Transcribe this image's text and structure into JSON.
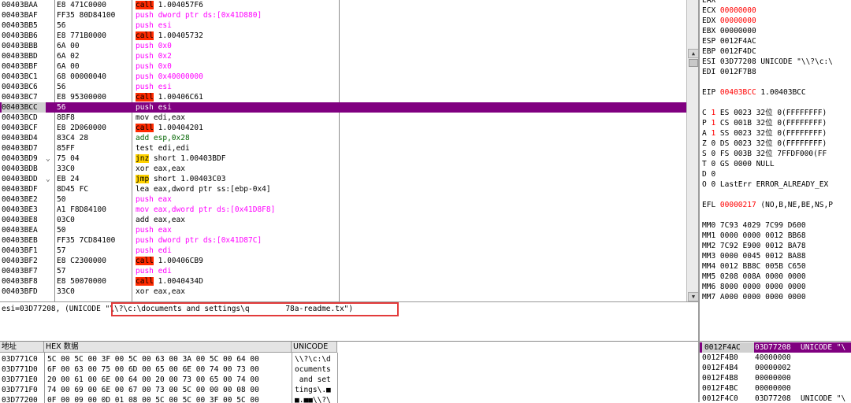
{
  "disasm": [
    {
      "addr": "00403BAA",
      "mark": "",
      "hex": "E8 471C0000",
      "m": "call",
      "mt": "call",
      "ops": "1.004057F6",
      "oc": "o-blk"
    },
    {
      "addr": "00403BAF",
      "mark": "",
      "hex": "FF35 80D84100",
      "m": "push",
      "mt": "push",
      "ops": "dword ptr ds:[0x41D880]",
      "oc": "o-push"
    },
    {
      "addr": "00403BB5",
      "mark": "",
      "hex": "56",
      "m": "push",
      "mt": "push",
      "ops": "esi",
      "oc": "o-push"
    },
    {
      "addr": "00403BB6",
      "mark": "",
      "hex": "E8 771B0000",
      "m": "call",
      "mt": "call",
      "ops": "1.00405732",
      "oc": "o-blk"
    },
    {
      "addr": "00403BBB",
      "mark": "",
      "hex": "6A 00",
      "m": "push",
      "mt": "push",
      "ops": "0x0",
      "oc": "o-push"
    },
    {
      "addr": "00403BBD",
      "mark": "",
      "hex": "6A 02",
      "m": "push",
      "mt": "push",
      "ops": "0x2",
      "oc": "o-push"
    },
    {
      "addr": "00403BBF",
      "mark": "",
      "hex": "6A 00",
      "m": "push",
      "mt": "push",
      "ops": "0x0",
      "oc": "o-push"
    },
    {
      "addr": "00403BC1",
      "mark": "",
      "hex": "68 00000040",
      "m": "push",
      "mt": "push",
      "ops": "0x40000000",
      "oc": "o-push"
    },
    {
      "addr": "00403BC6",
      "mark": "",
      "hex": "56",
      "m": "push",
      "mt": "push",
      "ops": "esi",
      "oc": "o-push"
    },
    {
      "addr": "00403BC7",
      "mark": "",
      "hex": "E8 95300000",
      "m": "call",
      "mt": "call",
      "ops": "1.00406C61",
      "oc": "o-blk"
    },
    {
      "addr": "00403BCC",
      "mark": "",
      "hex": "56",
      "m": "push",
      "mt": "push",
      "ops": "esi",
      "oc": "o-push",
      "sel": true
    },
    {
      "addr": "00403BCD",
      "mark": "",
      "hex": "8BF8",
      "m": "mov",
      "mt": "plain",
      "ops": "edi,eax",
      "oc": "o-blk"
    },
    {
      "addr": "00403BCF",
      "mark": "",
      "hex": "E8 2D060000",
      "m": "call",
      "mt": "call",
      "ops": "1.00404201",
      "oc": "o-blk"
    },
    {
      "addr": "00403BD4",
      "mark": "",
      "hex": "83C4 28",
      "m": "add",
      "mt": "plain",
      "ops": "esp,0x28",
      "oc": "o-darkgreen"
    },
    {
      "addr": "00403BD7",
      "mark": "",
      "hex": "85FF",
      "m": "test",
      "mt": "plain",
      "ops": "edi,edi",
      "oc": "o-blk"
    },
    {
      "addr": "00403BD9",
      "mark": "⌄",
      "hex": "75 04",
      "m": "jnz",
      "mt": "jmp",
      "ops": "short 1.00403BDF",
      "oc": "o-blk"
    },
    {
      "addr": "00403BDB",
      "mark": "",
      "hex": "33C0",
      "m": "xor",
      "mt": "plain",
      "ops": "eax,eax",
      "oc": "o-blk"
    },
    {
      "addr": "00403BDD",
      "mark": "⌄",
      "hex": "EB 24",
      "m": "jmp",
      "mt": "jmp",
      "ops": "short 1.00403C03",
      "oc": "o-blk"
    },
    {
      "addr": "00403BDF",
      "mark": "",
      "hex": "8D45 FC",
      "m": "lea",
      "mt": "plain",
      "ops": "eax,dword ptr ss:[ebp-0x4]",
      "oc": "o-blk"
    },
    {
      "addr": "00403BE2",
      "mark": "",
      "hex": "50",
      "m": "push",
      "mt": "push",
      "ops": "eax",
      "oc": "o-push"
    },
    {
      "addr": "00403BE3",
      "mark": "",
      "hex": "A1 F8D84100",
      "m": "mov",
      "mt": "plain",
      "ops": "eax,dword ptr ds:[0x41D8F8]",
      "oc": "o-push"
    },
    {
      "addr": "00403BE8",
      "mark": "",
      "hex": "03C0",
      "m": "add",
      "mt": "plain",
      "ops": "eax,eax",
      "oc": "o-blk"
    },
    {
      "addr": "00403BEA",
      "mark": "",
      "hex": "50",
      "m": "push",
      "mt": "push",
      "ops": "eax",
      "oc": "o-push"
    },
    {
      "addr": "00403BEB",
      "mark": "",
      "hex": "FF35 7CD84100",
      "m": "push",
      "mt": "push",
      "ops": "dword ptr ds:[0x41D87C]",
      "oc": "o-push"
    },
    {
      "addr": "00403BF1",
      "mark": "",
      "hex": "57",
      "m": "push",
      "mt": "push",
      "ops": "edi",
      "oc": "o-push"
    },
    {
      "addr": "00403BF2",
      "mark": "",
      "hex": "E8 C2300000",
      "m": "call",
      "mt": "call",
      "ops": "1.00406CB9",
      "oc": "o-blk"
    },
    {
      "addr": "00403BF7",
      "mark": "",
      "hex": "57",
      "m": "push",
      "mt": "push",
      "ops": "edi",
      "oc": "o-push"
    },
    {
      "addr": "00403BF8",
      "mark": "",
      "hex": "E8 50070000",
      "m": "call",
      "mt": "call",
      "ops": "1.0040434D",
      "oc": "o-blk"
    },
    {
      "addr": "00403BFD",
      "mark": "",
      "hex": "33C0",
      "m": "xor",
      "mt": "plain",
      "ops": "eax,eax",
      "oc": "o-blk"
    }
  ],
  "info_line": "esi=03D77208, (UNICODE \"\\\\?\\c:\\documents and settings\\q        78a-readme.tx\")",
  "registers": [
    {
      "label": "EAX",
      "value": "",
      "style": "redbar"
    },
    {
      "label": "ECX",
      "value": "00000000",
      "style": "red"
    },
    {
      "label": "EDX",
      "value": "00000000",
      "style": "red"
    },
    {
      "label": "EBX",
      "value": "00000000",
      "style": "blk"
    },
    {
      "label": "ESP",
      "value": "0012F4AC",
      "style": "blk"
    },
    {
      "label": "EBP",
      "value": "0012F4DC",
      "style": "blk"
    },
    {
      "label": "ESI",
      "value": "03D77208 UNICODE \"\\\\?\\c:\\",
      "style": "blk"
    },
    {
      "label": "EDI",
      "value": "0012F7B8",
      "style": "blk"
    },
    {
      "label": "",
      "value": "",
      "style": "blank"
    },
    {
      "label": "EIP",
      "value": "00403BCC",
      "extra": "1.00403BCC",
      "style": "eip"
    },
    {
      "label": "",
      "value": "",
      "style": "blank"
    },
    {
      "label": "C 1",
      "value": "ES 0023 32位 0(FFFFFFFF)",
      "style": "flag"
    },
    {
      "label": "P 1",
      "value": "CS 001B 32位 0(FFFFFFFF)",
      "style": "flag"
    },
    {
      "label": "A 1",
      "value": "SS 0023 32位 0(FFFFFFFF)",
      "style": "flag"
    },
    {
      "label": "Z 0",
      "value": "DS 0023 32位 0(FFFFFFFF)",
      "style": "flag0"
    },
    {
      "label": "S 0",
      "value": "FS 003B 32位 7FFDF000(FF",
      "style": "flag0"
    },
    {
      "label": "T 0",
      "value": "GS 0000 NULL",
      "style": "flag0"
    },
    {
      "label": "D 0",
      "value": "",
      "style": "flag0"
    },
    {
      "label": "O 0",
      "value": "LastErr ERROR_ALREADY_EX",
      "style": "flag0"
    },
    {
      "label": "",
      "value": "",
      "style": "blank"
    },
    {
      "label": "EFL",
      "value": "00000217",
      "extra": "(NO,B,NE,BE,NS,P",
      "style": "efl"
    },
    {
      "label": "",
      "value": "",
      "style": "blank"
    },
    {
      "label": "MM0",
      "value": "7C93 4029 7C99 D600",
      "style": "blk"
    },
    {
      "label": "MM1",
      "value": "0000 0000 0012 BB68",
      "style": "blk"
    },
    {
      "label": "MM2",
      "value": "7C92 E900 0012 BA78",
      "style": "blk"
    },
    {
      "label": "MM3",
      "value": "0000 0045 0012 BA88",
      "style": "blk"
    },
    {
      "label": "MM4",
      "value": "0012 BB8C 005B C650",
      "style": "blk"
    },
    {
      "label": "MM5",
      "value": "0208 008A 0000 0000",
      "style": "blk"
    },
    {
      "label": "MM6",
      "value": "8000 0000 0000 0000",
      "style": "blk"
    },
    {
      "label": "MM7",
      "value": "A000 0000 0000 0000",
      "style": "blk"
    }
  ],
  "dump": {
    "headers": {
      "addr": "地址",
      "hex": "HEX 数据",
      "uni": "UNICODE"
    },
    "rows": [
      {
        "addr": "03D771C0",
        "hex": "5C 00 5C 00 3F 00 5C 00 63 00 3A 00 5C 00 64 00",
        "uni": "\\\\?\\c:\\d"
      },
      {
        "addr": "03D771D0",
        "hex": "6F 00 63 00 75 00 6D 00 65 00 6E 00 74 00 73 00",
        "uni": "ocuments"
      },
      {
        "addr": "03D771E0",
        "hex": "20 00 61 00 6E 00 64 00 20 00 73 00 65 00 74 00",
        "uni": " and set"
      },
      {
        "addr": "03D771F0",
        "hex": "74 00 69 00 6E 00 67 00 73 00 5C 00 00 00 08 00",
        "uni": "tings\\.■"
      },
      {
        "addr": "03D77200",
        "hex": "0F 00 09 00 0D 01 08 00 5C 00 5C 00 3F 00 5C 00",
        "uni": "■.■■\\\\?\\"
      }
    ]
  },
  "stack": [
    {
      "addr": "0012F4AC",
      "val": "03D77208",
      "cmt": "UNICODE \"\\",
      "sel": true
    },
    {
      "addr": "0012F4B0",
      "val": "40000000",
      "cmt": ""
    },
    {
      "addr": "0012F4B4",
      "val": "00000002",
      "cmt": ""
    },
    {
      "addr": "0012F4B8",
      "val": "00000000",
      "cmt": ""
    },
    {
      "addr": "0012F4BC",
      "val": "00000000",
      "cmt": ""
    },
    {
      "addr": "0012F4C0",
      "val": "03D77208",
      "cmt": "UNICODE \"\\"
    }
  ],
  "icons": {
    "scroll_up": "▲",
    "scroll_down": "▼"
  }
}
